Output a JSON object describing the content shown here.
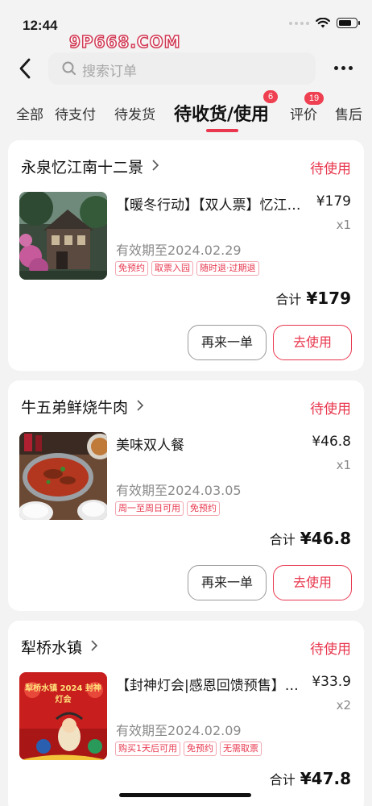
{
  "status_bar": {
    "time": "12:44",
    "watermark": "9P668.COM"
  },
  "search": {
    "placeholder": "搜索订单"
  },
  "tabs": [
    {
      "label": "全部"
    },
    {
      "label": "待支付"
    },
    {
      "label": "待发货"
    },
    {
      "label": "待收货/使用",
      "badge": "6",
      "active": true
    },
    {
      "label": "评价",
      "badge": "19"
    },
    {
      "label": "售后"
    }
  ],
  "orders": [
    {
      "store": "永泉忆江南十二景",
      "status": "待使用",
      "product": "【暖冬行动】【双人票】忆江南十二景",
      "price": "¥179",
      "qty": "x1",
      "valid": "有效期至2024.02.29",
      "tags": [
        "免预约",
        "取票入园",
        "随时退·过期退"
      ],
      "total_label": "合计",
      "total": "¥179",
      "again_label": "再来一单",
      "use_label": "去使用"
    },
    {
      "store": "牛五弟鲜烧牛肉",
      "status": "待使用",
      "product": "美味双人餐",
      "price": "¥46.8",
      "qty": "x1",
      "valid": "有效期至2024.03.05",
      "tags": [
        "周一至周日可用",
        "免预约"
      ],
      "total_label": "合计",
      "total": "¥46.8",
      "again_label": "再来一单",
      "use_label": "去使用"
    },
    {
      "store": "犁桥水镇",
      "status": "待使用",
      "product": "【封神灯会|感恩回馈预售】犁桥水镇",
      "price": "¥33.9",
      "qty": "x2",
      "valid": "有效期至2024.02.09",
      "tags": [
        "购买1天后可用",
        "免预约",
        "无需取票"
      ],
      "total_label": "合计",
      "total": "¥47.8",
      "poster_text": "犁桥水镇 2024 封神 灯会"
    }
  ]
}
